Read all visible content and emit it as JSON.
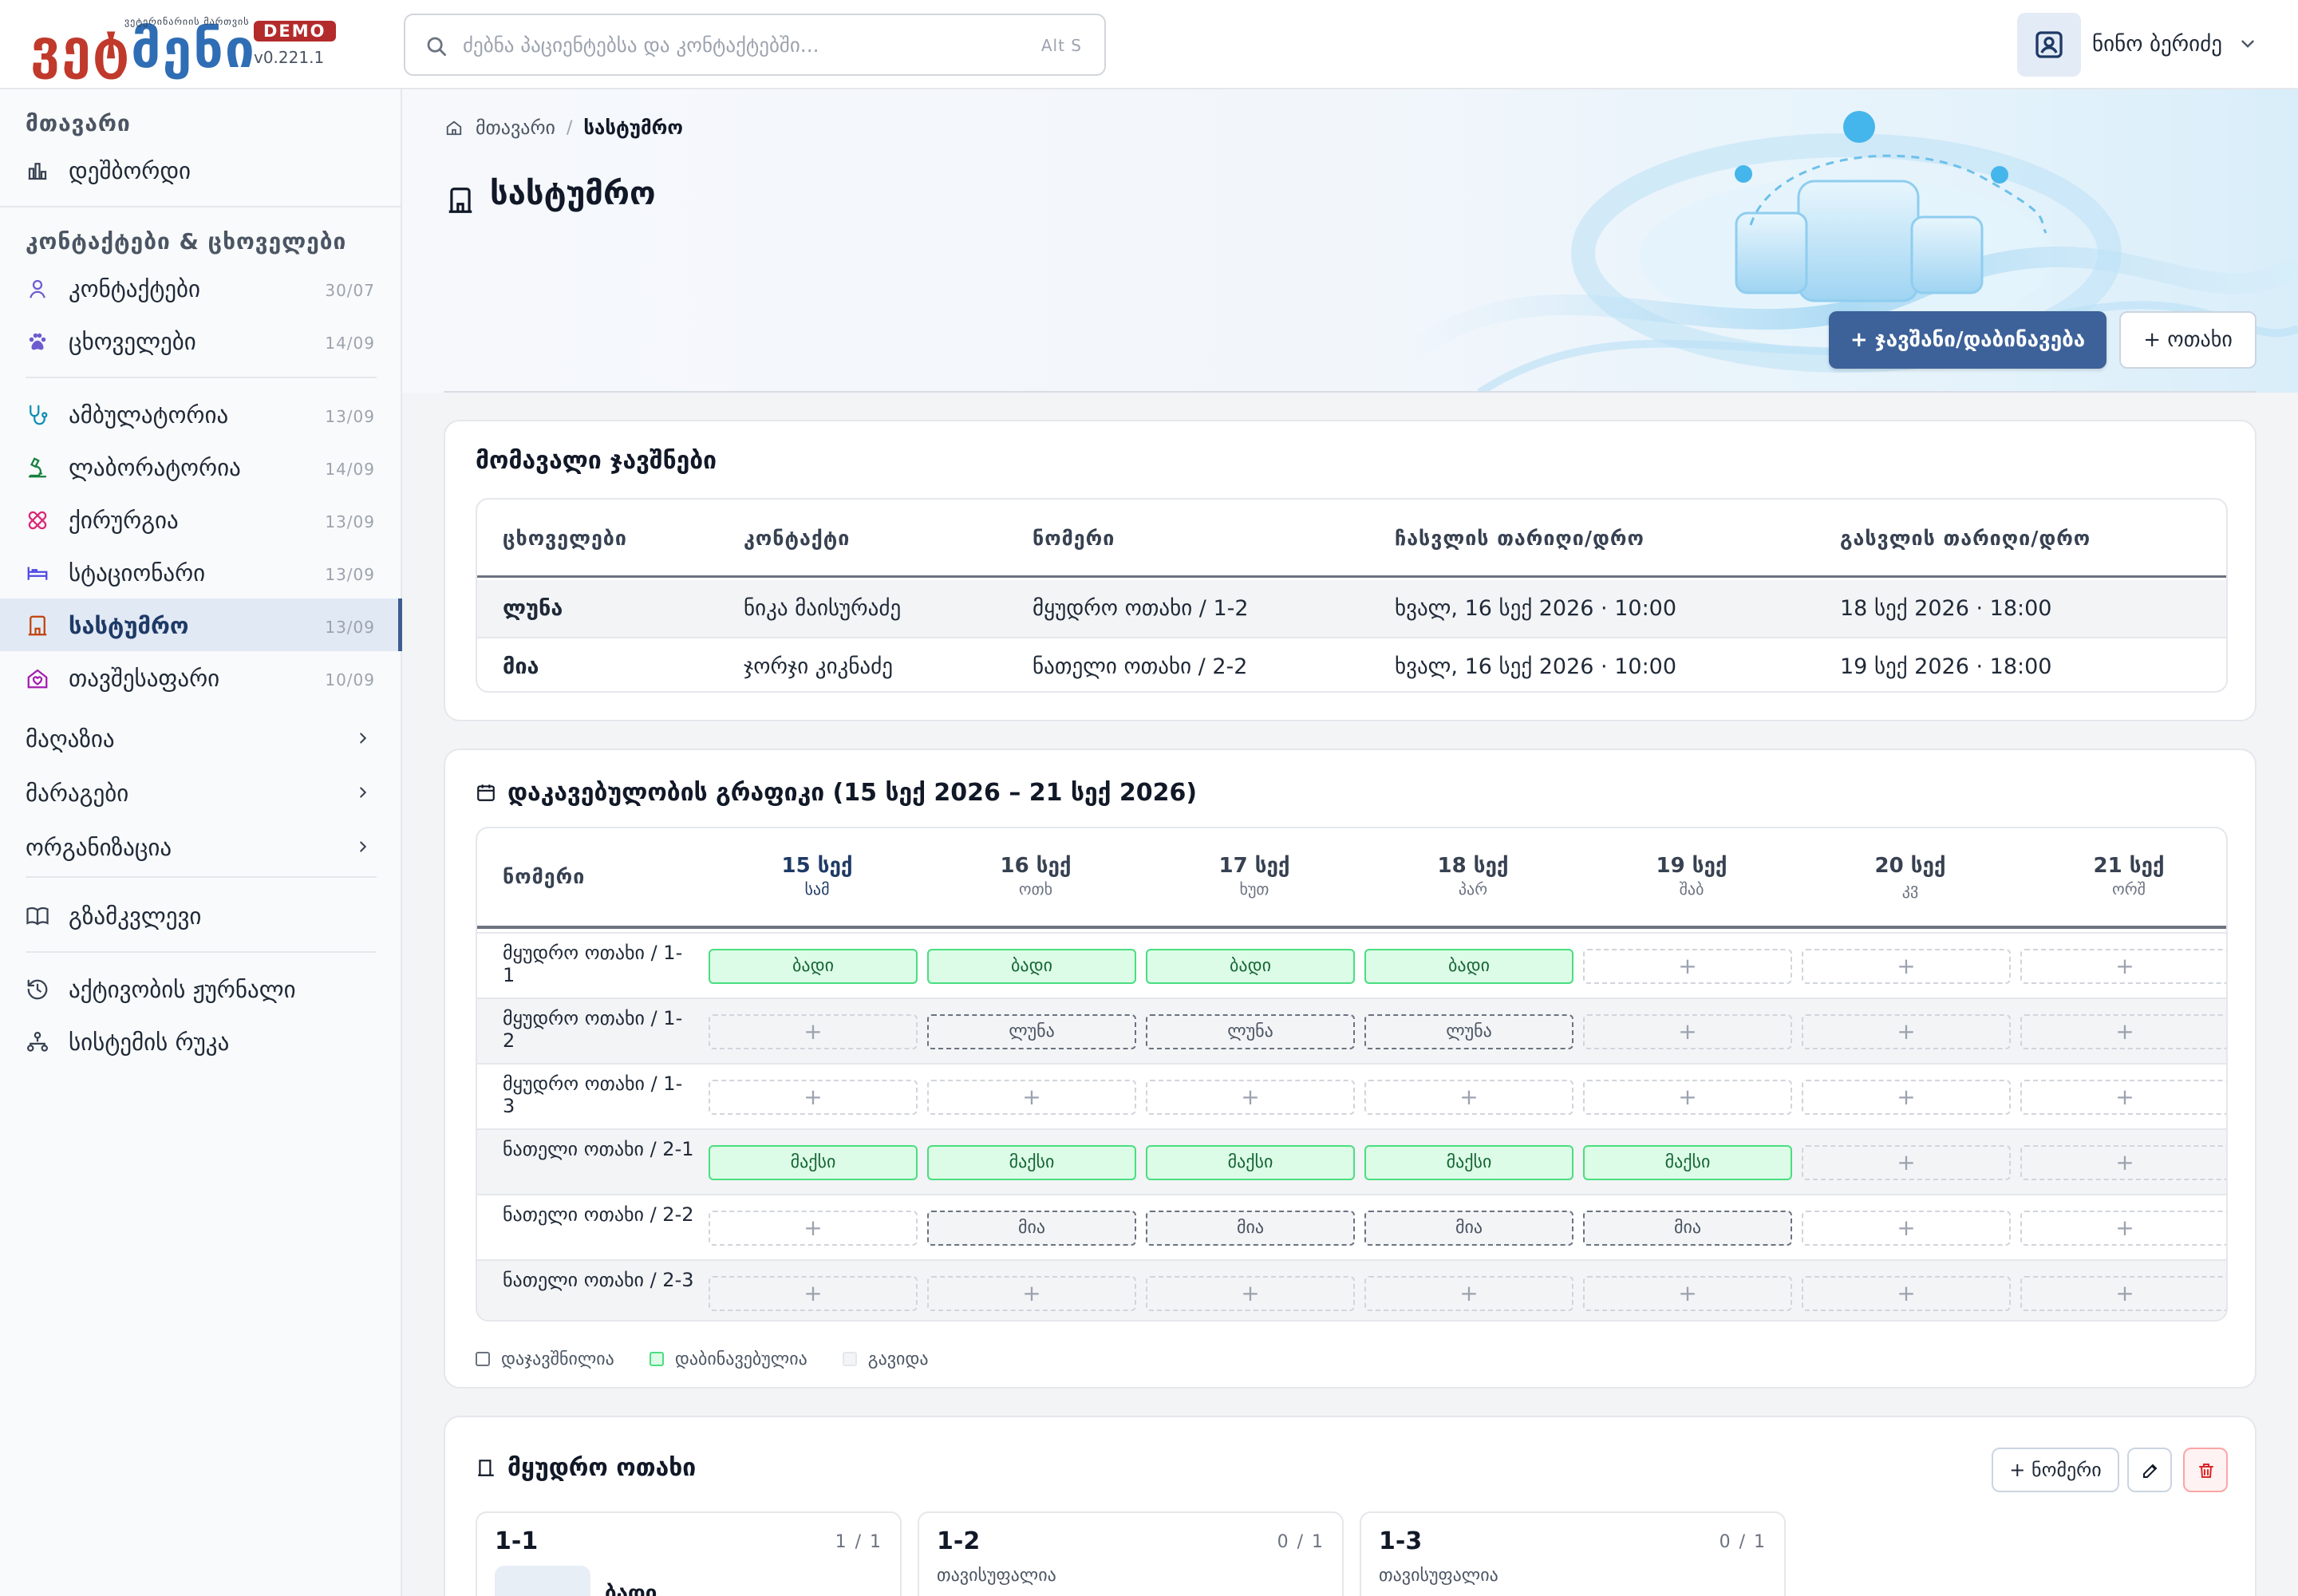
{
  "brand": {
    "logo_red_1": "ვე",
    "logo_red_2": "ტ",
    "logo_blue": "მ",
    "logo_red_3": "ე",
    "logo_blue_2": "ნ",
    "logo_red_4": "ი",
    "tagline": "ვეტერინარიის მართვის",
    "demo": "DEMO",
    "version": "v0.221.1"
  },
  "search": {
    "placeholder": "ძებნა პაციენტებსა და კონტაქტებში...",
    "shortcut": "Alt S"
  },
  "user": {
    "name": "ნინო ბერიძე"
  },
  "sidebar": {
    "section_main": "მთავარი",
    "dashboard": "დეშბორდი",
    "section_contacts": "კონტაქტები & ცხოველები",
    "contacts": {
      "label": "კონტაქტები",
      "count": "30/07"
    },
    "animals": {
      "label": "ცხოველები",
      "count": "14/09"
    },
    "ambulatory": {
      "label": "ამბულატორია",
      "count": "13/09"
    },
    "laboratory": {
      "label": "ლაბორატორია",
      "count": "14/09"
    },
    "surgery": {
      "label": "ქირურგია",
      "count": "13/09"
    },
    "stationary": {
      "label": "სტაციონარი",
      "count": "13/09"
    },
    "hotel": {
      "label": "სასტუმრო",
      "count": "13/09"
    },
    "shelter": {
      "label": "თავშესაფარი",
      "count": "10/09"
    },
    "shop": "მაღაზია",
    "inventory": "მარაგები",
    "organization": "ორგანიზაცია",
    "guide": "გზამკვლევი",
    "activity_log": "აქტივობის ჟურნალი",
    "system_map": "სისტემის რუკა"
  },
  "breadcrumb": {
    "home": "მთავარი",
    "current": "სასტუმრო"
  },
  "page": {
    "title": "სასტუმრო",
    "primary_button": "+ ჯავშანი/დაბინავება",
    "room_button": "+ ოთახი"
  },
  "upcoming": {
    "title": "მომავალი ჯავშნები",
    "headers": [
      "ცხოველები",
      "კონტაქტი",
      "ნომერი",
      "ჩასვლის თარიღი/დრო",
      "გასვლის თარიღი/დრო"
    ],
    "rows": [
      [
        "ლუნა",
        "ნიკა მაისურაძე",
        "მყუდრო ოთახი / 1-2",
        "ხვალ, 16 სექ 2026 · 10:00",
        "18 სექ 2026 · 18:00"
      ],
      [
        "მია",
        "ჯორჯი კიკნაძე",
        "ნათელი ოთახი / 2-2",
        "ხვალ, 16 სექ 2026 · 10:00",
        "19 სექ 2026 · 18:00"
      ]
    ]
  },
  "schedule": {
    "title": "დაკავებულობის გრაფიკი (15 სექ 2026 – 21 სექ 2026)",
    "room_header": "ნომერი",
    "days": [
      {
        "date": "15 სექ",
        "weekday": "სამ"
      },
      {
        "date": "16 სექ",
        "weekday": "ოთხ"
      },
      {
        "date": "17 სექ",
        "weekday": "ხუთ"
      },
      {
        "date": "18 სექ",
        "weekday": "პარ"
      },
      {
        "date": "19 სექ",
        "weekday": "შაბ"
      },
      {
        "date": "20 სექ",
        "weekday": "კვ"
      },
      {
        "date": "21 სექ",
        "weekday": "ორშ"
      }
    ],
    "empty_symbol": "+",
    "rows": [
      {
        "room": "მყუდრო ოთახი / 1-1",
        "cells": [
          [
            "in",
            "ბადი"
          ],
          [
            "in",
            "ბადი"
          ],
          [
            "in",
            "ბადი"
          ],
          [
            "in",
            "ბადი"
          ],
          [
            "empty",
            ""
          ],
          [
            "empty",
            ""
          ],
          [
            "empty",
            ""
          ]
        ]
      },
      {
        "room": "მყუდრო ოთახი / 1-2",
        "cells": [
          [
            "empty",
            ""
          ],
          [
            "reserved",
            "ლუნა"
          ],
          [
            "reserved",
            "ლუნა"
          ],
          [
            "reserved",
            "ლუნა"
          ],
          [
            "empty",
            ""
          ],
          [
            "empty",
            ""
          ],
          [
            "empty",
            ""
          ]
        ]
      },
      {
        "room": "მყუდრო ოთახი / 1-3",
        "cells": [
          [
            "empty",
            ""
          ],
          [
            "empty",
            ""
          ],
          [
            "empty",
            ""
          ],
          [
            "empty",
            ""
          ],
          [
            "empty",
            ""
          ],
          [
            "empty",
            ""
          ],
          [
            "empty",
            ""
          ]
        ]
      },
      {
        "room": "ნათელი ოთახი / 2-1",
        "cells": [
          [
            "in",
            "მაქსი"
          ],
          [
            "in",
            "მაქსი"
          ],
          [
            "in",
            "მაქსი"
          ],
          [
            "in",
            "მაქსი"
          ],
          [
            "in",
            "მაქსი"
          ],
          [
            "empty",
            ""
          ],
          [
            "empty",
            ""
          ]
        ]
      },
      {
        "room": "ნათელი ოთახი / 2-2",
        "cells": [
          [
            "empty",
            ""
          ],
          [
            "reserved",
            "მია"
          ],
          [
            "reserved",
            "მია"
          ],
          [
            "reserved",
            "მია"
          ],
          [
            "reserved",
            "მია"
          ],
          [
            "empty",
            ""
          ],
          [
            "empty",
            ""
          ]
        ]
      },
      {
        "room": "ნათელი ოთახი / 2-3",
        "cells": [
          [
            "empty",
            ""
          ],
          [
            "empty",
            ""
          ],
          [
            "empty",
            ""
          ],
          [
            "empty",
            ""
          ],
          [
            "empty",
            ""
          ],
          [
            "empty",
            ""
          ],
          [
            "empty",
            ""
          ]
        ]
      }
    ],
    "legend": {
      "reserved": "დაჯავშნილია",
      "checked_in": "დაბინავებულია",
      "departed": "გავიდა"
    }
  },
  "rooms_section": {
    "title": "მყუდრო ოთახი",
    "add_number_button": "+ ნომერი",
    "cards": [
      {
        "number": "1-1",
        "capacity": "1 / 1",
        "pet": "ბადი"
      },
      {
        "number": "1-2",
        "capacity": "0 / 1",
        "status": "თავისუფალია"
      },
      {
        "number": "1-3",
        "capacity": "0 / 1",
        "status": "თავისუფალია"
      }
    ]
  },
  "colors": {
    "accent": "#3d6199",
    "checked_in_fill": "#dcfce7",
    "checked_in_border": "#4ade80",
    "danger": "#dc2626"
  }
}
